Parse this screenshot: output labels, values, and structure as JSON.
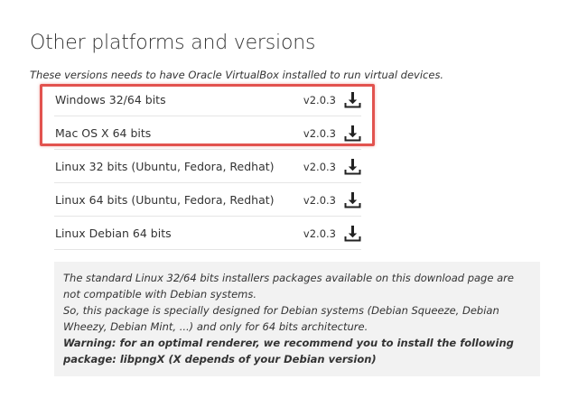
{
  "page": {
    "title": "Other platforms and versions",
    "intro": "These versions needs to have Oracle VirtualBox installed to run virtual devices."
  },
  "colors": {
    "highlight": "#e2534f",
    "text": "#333333",
    "note_background": "#f2f2f2"
  },
  "downloads": [
    {
      "platform": "Windows 32/64 bits",
      "version": "v2.0.3",
      "icon": "download-icon",
      "highlighted": true
    },
    {
      "platform": "Mac OS X 64 bits",
      "version": "v2.0.3",
      "icon": "download-icon",
      "highlighted": true
    },
    {
      "platform": "Linux 32 bits (Ubuntu, Fedora, Redhat)",
      "version": "v2.0.3",
      "icon": "download-icon",
      "highlighted": false
    },
    {
      "platform": "Linux 64 bits (Ubuntu, Fedora, Redhat)",
      "version": "v2.0.3",
      "icon": "download-icon",
      "highlighted": false
    },
    {
      "platform": "Linux Debian 64 bits",
      "version": "v2.0.3",
      "icon": "download-icon",
      "highlighted": false
    }
  ],
  "debian_note": {
    "line1": "The standard Linux 32/64 bits installers packages available on this download page are not compatible with Debian systems.",
    "line2": "So, this package is specially designed for Debian systems (Debian Squeeze, Debian Wheezy, Debian Mint, ...) and only for 64 bits architecture.",
    "warning": "Warning: for an optimal renderer, we recommend you to install the following package: libpngX (X depends of your Debian version)"
  }
}
